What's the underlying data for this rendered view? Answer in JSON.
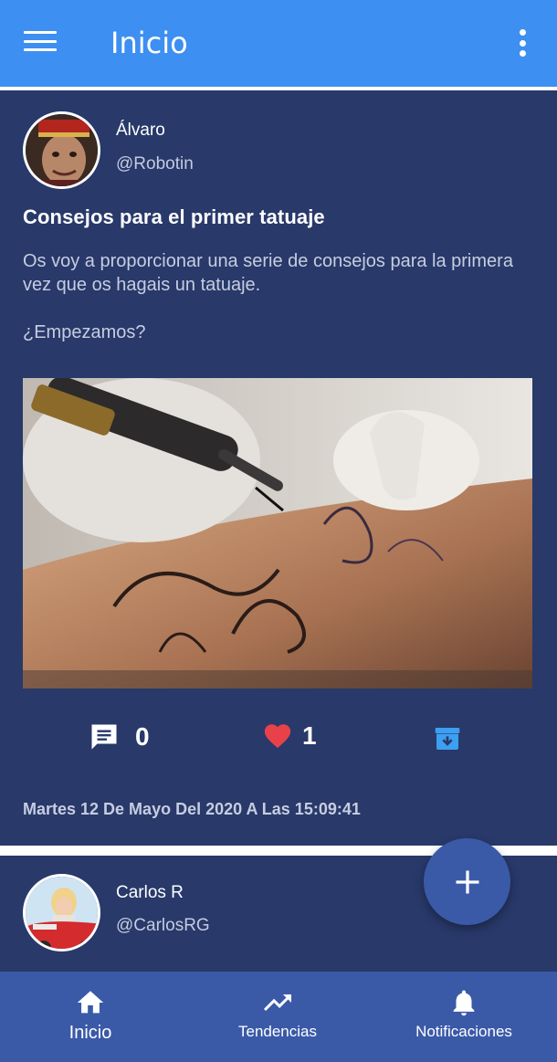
{
  "appbar": {
    "title": "Inicio",
    "menu_icon": "menu-icon",
    "more_icon": "more-vert-icon"
  },
  "posts": [
    {
      "author_name": "Álvaro",
      "author_handle": "@Robotin",
      "title": "Consejos para el primer tatuaje",
      "body_line1": "Os voy a proporcionar una serie de consejos para la primera vez que os hagais un tatuaje.",
      "body_line2": "¿Empezamos?",
      "comments_count": "0",
      "likes_count": "1",
      "timestamp": "Martes 12 De Mayo Del 2020 A Las 15:09:41",
      "comment_icon": "comment-icon",
      "like_icon": "heart-icon",
      "save_icon": "archive-icon"
    },
    {
      "author_name": "Carlos R",
      "author_handle": "@CarlosRG"
    }
  ],
  "fab": {
    "icon": "plus-icon"
  },
  "bottom_nav": {
    "items": [
      {
        "label": "Inicio",
        "icon": "home-icon"
      },
      {
        "label": "Tendencias",
        "icon": "trending-up-icon"
      },
      {
        "label": "Notificaciones",
        "icon": "bell-icon"
      }
    ]
  },
  "colors": {
    "appbar": "#3d8ff2",
    "card": "#28396a",
    "bottom_nav": "#3a5aa8",
    "like": "#e8414a",
    "archive": "#3d9ff0"
  }
}
